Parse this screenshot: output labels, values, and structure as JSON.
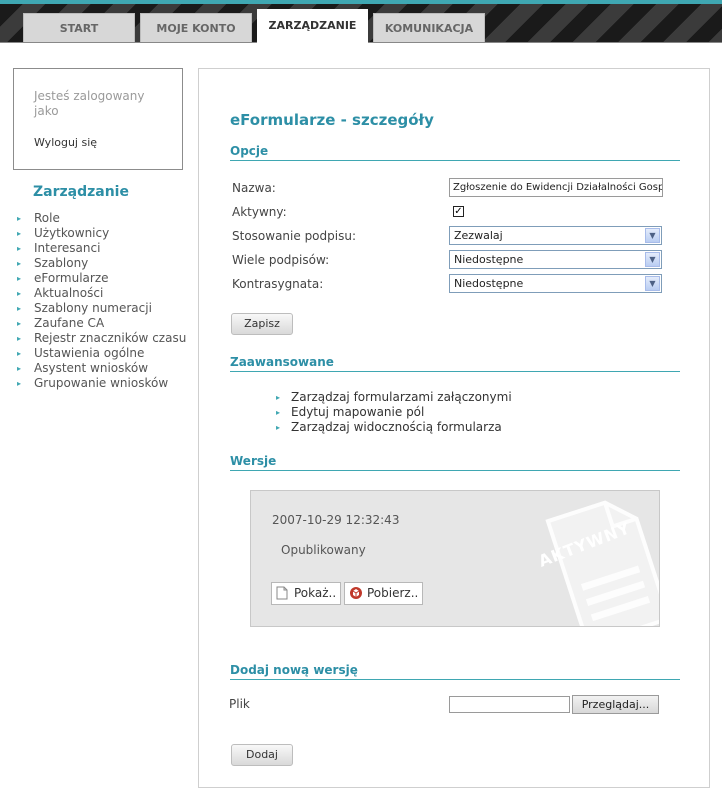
{
  "tabs": [
    {
      "label": "START",
      "active": false
    },
    {
      "label": "MOJE KONTO",
      "active": false
    },
    {
      "label": "ZARZĄDZANIE",
      "active": true
    },
    {
      "label": "KOMUNIKACJA",
      "active": false
    }
  ],
  "sidebar": {
    "login_text": "Jesteś zalogowany jako",
    "logout_label": "Wyloguj się",
    "title": "Zarządzanie",
    "items": [
      "Role",
      "Użytkownicy",
      "Interesanci",
      "Szablony",
      "eFormularze",
      "Aktualności",
      "Szablony numeracji",
      "Zaufane CA",
      "Rejestr znaczników czasu",
      "Ustawienia ogólne",
      "Asystent wniosków",
      "Grupowanie wniosków"
    ]
  },
  "main": {
    "title": "eFormularze - szczegóły",
    "options": {
      "heading": "Opcje",
      "name_label": "Nazwa:",
      "name_value": "Zgłoszenie do Ewidencji Działalności Gospo",
      "active_label": "Aktywny:",
      "active_checked": true,
      "signature_label": "Stosowanie podpisu:",
      "signature_value": "Zezwalaj",
      "multi_signatures_label": "Wiele podpisów:",
      "multi_signatures_value": "Niedostępne",
      "countersign_label": "Kontrasygnata:",
      "countersign_value": "Niedostępne",
      "save_label": "Zapisz"
    },
    "advanced": {
      "heading": "Zaawansowane",
      "links": [
        "Zarządzaj formularzami załączonymi",
        "Edytuj mapowanie pól",
        "Zarządzaj widocznością formularza"
      ]
    },
    "versions": {
      "heading": "Wersje",
      "date": "2007-10-29 12:32:43",
      "status": "Opublikowany",
      "stamp": "AKTYWNY",
      "show_label": "Pokaż..",
      "download_label": "Pobierz.."
    },
    "new_version": {
      "heading": "Dodaj nową wersję",
      "file_label": "Plik",
      "browse_label": "Przeglądaj...",
      "add_label": "Dodaj"
    }
  },
  "colors": {
    "accent": "#2d8fa6",
    "tab_bar": "#2a2a2a",
    "version_bg": "#e6e6e6"
  }
}
